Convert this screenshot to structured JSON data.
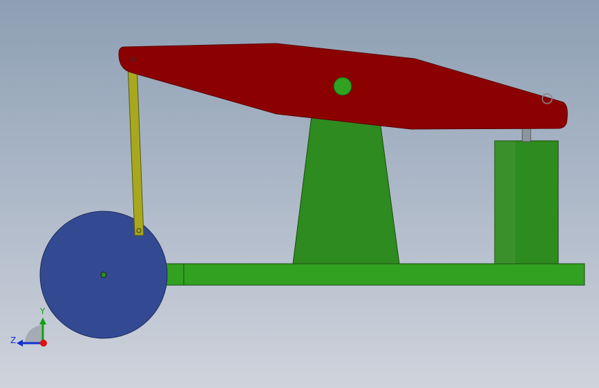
{
  "colors": {
    "beam": "#8b0000",
    "frame": "#2e8b1f",
    "base": "#32a020",
    "crank": "#334a93",
    "rod": "#a8a81e",
    "piston_rod": "#8c96a0",
    "axis_x": "#e01010",
    "axis_y": "#10a010",
    "axis_z": "#1030d0"
  },
  "triad": {
    "y_label": "Y",
    "z_label": "Z"
  }
}
